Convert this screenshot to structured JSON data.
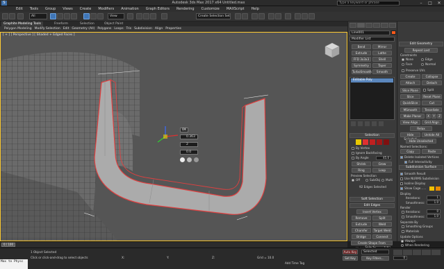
{
  "titlebar": {
    "app_icon": "3ds-max-logo-icon",
    "title": "Autodesk 3ds Max 2017 x64   Untitled.max",
    "search_placeholder": "Type a keyword or phrase",
    "minimize": "–",
    "maximize": "□",
    "close": "✕"
  },
  "menubar": {
    "items": [
      "Edit",
      "Tools",
      "Group",
      "Views",
      "Create",
      "Modifiers",
      "Animation",
      "Graph Editors",
      "Rendering",
      "Customize",
      "MAXScript",
      "Help"
    ]
  },
  "toolbar": {
    "filter_value": "All",
    "refcoord_value": "View",
    "selection_set_placeholder": "Create Selection Set"
  },
  "ribbon": {
    "tabs": [
      "Graphite Modeling Tools",
      "Freeform",
      "Selection",
      "Object Paint"
    ],
    "active_tab": 0,
    "subitems": [
      "Polygon Modeling",
      "Modify Selection",
      "Edit",
      "Geometry (All)",
      "Polygons",
      "Loops",
      "Tris",
      "Subdivision",
      "Align",
      "Properties"
    ]
  },
  "viewport": {
    "label": "[ + ] [ Perspective ] [ Shaded + Edged Faces ]",
    "caddy": {
      "ok_label": "OK",
      "field1": "0.363",
      "field2": "2",
      "field3": "0.0"
    }
  },
  "command_panel": {
    "object_name": "Line001",
    "modifier_list": "Modifier List",
    "modifier_buttons": [
      "Bend",
      "Mirror",
      "Extrude",
      "Lathe",
      "FFD 3x3x3",
      "Shell",
      "Symmetry",
      "Taper",
      "TurboSmooth",
      "Smooth"
    ],
    "stack_item": "Editable Poly",
    "selection_rollout": "Selection",
    "by_vertex": "By Vertex",
    "ignore_backfacing": "Ignore Backfacing",
    "by_angle": "By Angle",
    "by_angle_value": "45.0",
    "shrink": "Shrink",
    "grow": "Grow",
    "ring": "Ring",
    "loop": "Loop",
    "preview_selection": "Preview Selection",
    "preview_off": "Off",
    "preview_subobj": "SubObj",
    "preview_multi": "Multi",
    "edges_selected": "92 Edges Selected",
    "soft_selection": "Soft Selection",
    "edit_edges": "Edit Edges",
    "insert_vertex": "Insert Vertex",
    "remove": "Remove",
    "split": "Split",
    "extrude": "Extrude",
    "weld": "Weld",
    "chamfer": "Chamfer",
    "target_weld": "Target Weld",
    "bridge": "Bridge",
    "connect": "Connect",
    "create_shape": "Create Shape From Selection",
    "weight_label": "Weight:",
    "weight_value": "1.0",
    "crease_label": "Crease:",
    "crease_value": "0.0"
  },
  "right_panel": {
    "edit_geometry": "Edit Geometry",
    "repeat_last": "Repeat Last",
    "constraints": "Constraints",
    "none": "None",
    "edge": "Edge",
    "face": "Face",
    "normal": "Normal",
    "preserve_uvs": "Preserve UVs",
    "create": "Create",
    "collapse": "Collapse",
    "attach": "Attach",
    "detach": "Detach",
    "slice_plane": "Slice Plane",
    "split": "Split",
    "slice": "Slice",
    "reset_plane": "Reset Plane",
    "quickslice": "QuickSlice",
    "cut": "Cut",
    "msmooth": "MSmooth",
    "tessellate": "Tessellate",
    "make_planar": "Make Planar",
    "x": "X",
    "y": "Y",
    "z": "Z",
    "view_align": "View Align",
    "grid_align": "Grid Align",
    "relax": "Relax",
    "hide_selected": "Hide Selected",
    "unhide_all": "Unhide All",
    "hide_unselected": "Hide Unselected",
    "named_selections": "Named Selections:",
    "copy": "Copy",
    "paste": "Paste",
    "delete_isolated": "Delete Isolated Vertices",
    "full_interactivity": "Full Interactivity",
    "subdivision_surface": "Subdivision Surface",
    "smooth_result": "Smooth Result",
    "use_nurms": "Use NURMS Subdivision",
    "isoline_display": "Isoline Display",
    "show_cage": "Show Cage......",
    "display": "Display",
    "iterations_label": "Iterations:",
    "iterations_value": "1",
    "smoothness_label": "Smoothness:",
    "smoothness_value": "1.0",
    "render": "Render",
    "r_iterations_value": "0",
    "r_smoothness_value": "1.0",
    "separate_by": "Separate By",
    "smoothing_groups": "Smoothing Groups",
    "materials": "Materials",
    "update_options": "Update Options",
    "always": "Always",
    "when_rendering": "When Rendering",
    "manually": "Manually",
    "cage_color1": "#f0c000",
    "cage_color2": "#e88a00"
  },
  "statusbar": {
    "objects_selected": "1 Object Selected",
    "prompt": "Click or click-and-drag to select objects",
    "x_label": "X:",
    "y_label": "Y:",
    "z_label": "Z:",
    "grid": "Grid = 10.0",
    "autokey": "Auto Key",
    "selected": "Selected",
    "set_key": "Set Key",
    "key_filters": "Key Filters...",
    "add_time_tag": "Add Time Tag",
    "frame_value": "0",
    "frame_range": "0 / 100"
  },
  "maxscript": {
    "text": "Max to Physc"
  }
}
